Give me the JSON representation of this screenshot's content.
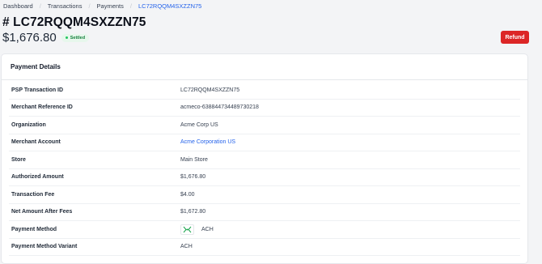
{
  "breadcrumb": [
    "Dashboard",
    "Transactions",
    "Payments",
    "LC72RQQM4SXZZN75"
  ],
  "header": {
    "title": "# LC72RQQM4SXZZN75",
    "amount": "$1,676.80",
    "status": "Settled",
    "refund_label": "Refund"
  },
  "card": {
    "title": "Payment Details",
    "rows": [
      {
        "label": "PSP Transaction ID",
        "value": "LC72RQQM4SXZZN75"
      },
      {
        "label": "Merchant Reference ID",
        "value": "acmeco-638844734489730218"
      },
      {
        "label": "Organization",
        "value": "Acme Corp US"
      },
      {
        "label": "Merchant Account",
        "value": "Acme Corporation US"
      },
      {
        "label": "Store",
        "value": "Main Store"
      },
      {
        "label": "Authorized Amount",
        "value": "$1,676.80"
      },
      {
        "label": "Transaction Fee",
        "value": "$4.00"
      },
      {
        "label": "Net Amount After Fees",
        "value": "$1,672.80"
      },
      {
        "label": "Payment Method",
        "value": "ACH",
        "icon": "ach-icon"
      },
      {
        "label": "Payment Method Variant",
        "value": "ACH"
      }
    ]
  },
  "colors": {
    "accent_link": "#2563eb",
    "refund": "#dc2626",
    "settled_bg": "#e7f7ec",
    "settled_text": "#15803d"
  }
}
